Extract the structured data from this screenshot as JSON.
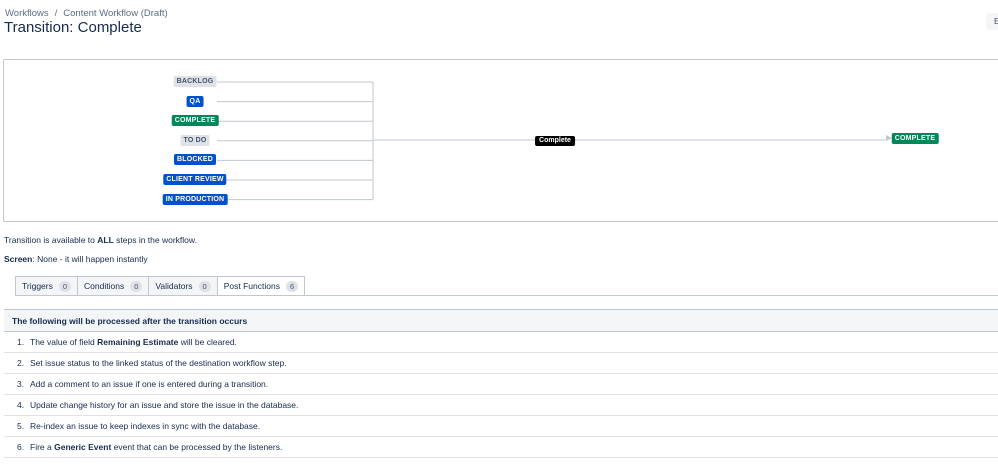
{
  "breadcrumb": {
    "root": "Workflows",
    "separator": "/",
    "workflow": "Content Workflow (Draft)"
  },
  "title": "Transition: Complete",
  "edit_button_label": "E",
  "diagram": {
    "source_statuses": [
      {
        "label": "BACKLOG",
        "category": "grey"
      },
      {
        "label": "QA",
        "category": "blue"
      },
      {
        "label": "COMPLETE",
        "category": "green"
      },
      {
        "label": "TO DO",
        "category": "grey"
      },
      {
        "label": "BLOCKED",
        "category": "blue"
      },
      {
        "label": "CLIENT REVIEW",
        "category": "blue"
      },
      {
        "label": "IN PRODUCTION",
        "category": "blue"
      }
    ],
    "transition_label": "Complete",
    "target_status": {
      "label": "COMPLETE",
      "category": "green"
    },
    "colors": {
      "grey": "#dfe1e6",
      "blue": "#0052cc",
      "green": "#00875a",
      "line": "#c1c7d0"
    }
  },
  "availability": {
    "prefix": "Transition is available to",
    "emphasis": "ALL",
    "suffix": "steps in the workflow."
  },
  "screen": {
    "label": "Screen",
    "value": ": None - it will happen instantly"
  },
  "tabs": [
    {
      "label": "Triggers",
      "count": "0",
      "active": false
    },
    {
      "label": "Conditions",
      "count": "0",
      "active": false
    },
    {
      "label": "Validators",
      "count": "0",
      "active": false
    },
    {
      "label": "Post Functions",
      "count": "6",
      "active": true
    }
  ],
  "post_functions": {
    "header": "The following will be processed after the transition occurs",
    "items": [
      {
        "num": "1.",
        "before": "The value of field",
        "bold": "Remaining Estimate",
        "after": "will be cleared."
      },
      {
        "num": "2.",
        "before": "Set issue status to the linked status of the destination workflow step.",
        "bold": "",
        "after": ""
      },
      {
        "num": "3.",
        "before": "Add a comment to an issue if one is entered during a transition.",
        "bold": "",
        "after": ""
      },
      {
        "num": "4.",
        "before": "Update change history for an issue and store the issue in the database.",
        "bold": "",
        "after": ""
      },
      {
        "num": "5.",
        "before": "Re-index an issue to keep indexes in sync with the database.",
        "bold": "",
        "after": ""
      },
      {
        "num": "6.",
        "before": "Fire a",
        "bold": "Generic Event",
        "after": "event that can be processed by the listeners."
      }
    ]
  }
}
